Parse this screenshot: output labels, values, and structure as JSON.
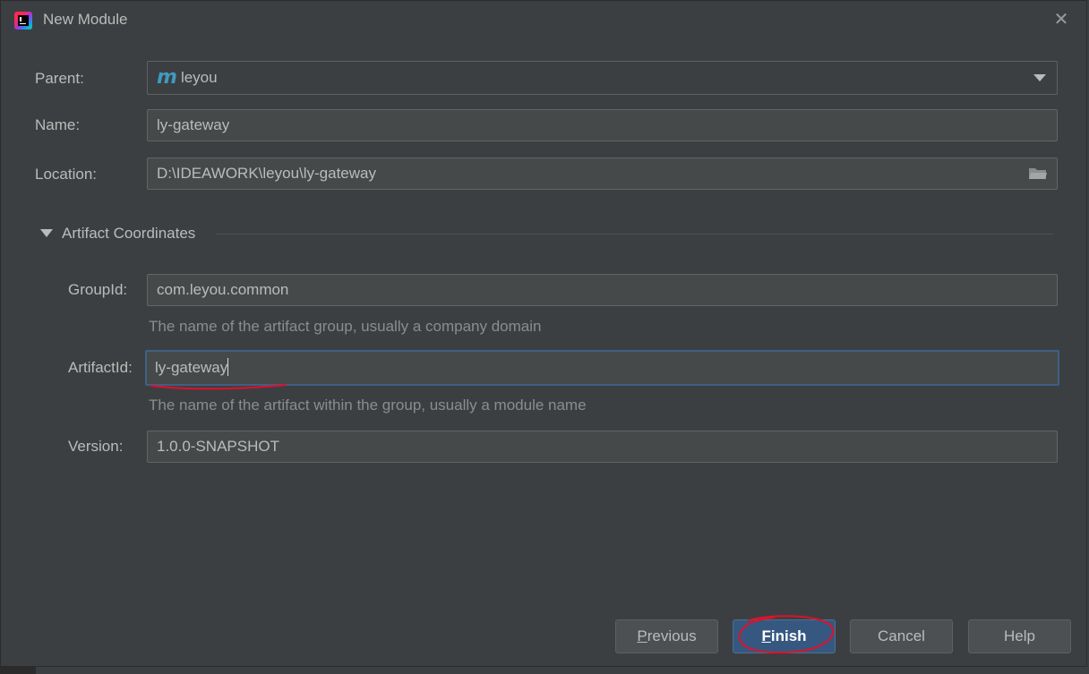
{
  "dialog": {
    "title": "New Module",
    "close_icon": "close-icon",
    "app_icon": "intellij-idea-icon"
  },
  "form": {
    "parent": {
      "label": "Parent:",
      "value": "leyou",
      "icon": "maven-module-icon"
    },
    "name": {
      "label": "Name:",
      "value": "ly-gateway"
    },
    "location": {
      "label": "Location:",
      "value": "D:\\IDEAWORK\\leyou\\ly-gateway",
      "icon": "folder-icon"
    }
  },
  "artifact": {
    "section_title": "Artifact Coordinates",
    "group_id": {
      "label": "GroupId:",
      "value": "com.leyou.common",
      "hint": "The name of the artifact group, usually a company domain"
    },
    "artifact_id": {
      "label": "ArtifactId:",
      "value": "ly-gateway",
      "hint": "The name of the artifact within the group, usually a module name"
    },
    "version": {
      "label": "Version:",
      "value": "1.0.0-SNAPSHOT"
    }
  },
  "buttons": {
    "previous": "Previous",
    "finish": "Finish",
    "cancel": "Cancel",
    "help": "Help"
  },
  "colors": {
    "background": "#3c3f41",
    "field_bg": "#45494a",
    "focus_border": "#3d6185",
    "primary_button": "#365880",
    "annotation_red": "#e0102a"
  }
}
